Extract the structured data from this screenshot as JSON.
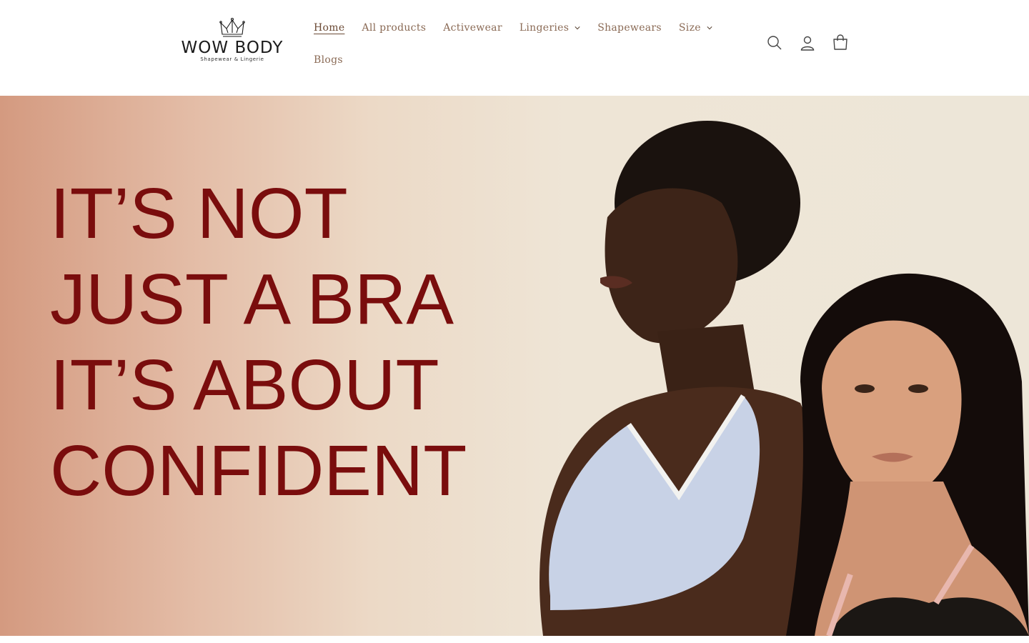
{
  "brand": {
    "name": "WOW BODY",
    "tagline": "Shapewear & Lingerie"
  },
  "nav": {
    "items": [
      {
        "label": "Home",
        "active": true,
        "dropdown": false
      },
      {
        "label": "All products",
        "active": false,
        "dropdown": false
      },
      {
        "label": "Activewear",
        "active": false,
        "dropdown": false
      },
      {
        "label": "Lingeries",
        "active": false,
        "dropdown": true
      },
      {
        "label": "Shapewears",
        "active": false,
        "dropdown": false
      },
      {
        "label": "Size",
        "active": false,
        "dropdown": true
      },
      {
        "label": "Blogs",
        "active": false,
        "dropdown": false
      }
    ]
  },
  "header_icons": [
    "search-icon",
    "account-icon",
    "cart-icon"
  ],
  "hero": {
    "lines": [
      "IT’S NOT",
      "JUST A BRA",
      "IT’S ABOUT",
      "CONFIDENT"
    ],
    "text_color": "#7a0d0d"
  },
  "colors": {
    "nav_text": "#8a6a55",
    "hero_left": "#d49a80",
    "hero_right": "#ede6d8"
  }
}
